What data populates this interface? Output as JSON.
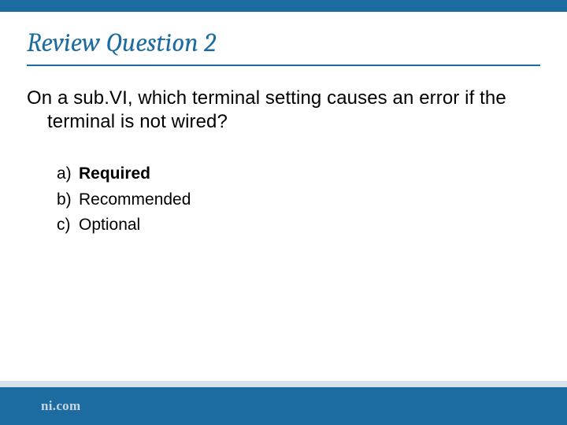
{
  "slide": {
    "title": "Review Question 2",
    "question_line1": "On a sub.VI, which terminal setting causes an",
    "question_line2": "error if the terminal is not wired?",
    "options": [
      {
        "letter": "a)",
        "text": "Required",
        "correct": true
      },
      {
        "letter": "b)",
        "text": "Recommended",
        "correct": false
      },
      {
        "letter": "c)",
        "text": "Optional",
        "correct": false
      }
    ],
    "footer_brand": "ni.com"
  }
}
